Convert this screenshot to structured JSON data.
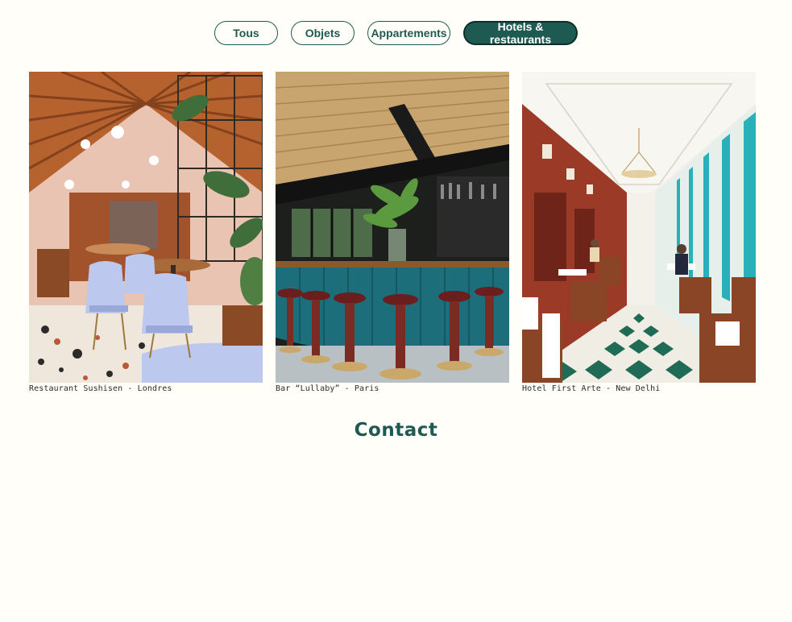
{
  "filters": {
    "items": [
      {
        "label": "Tous"
      },
      {
        "label": "Objets"
      },
      {
        "label": "Appartements"
      },
      {
        "label": "Hotels & restaurants"
      }
    ],
    "active_index": 3
  },
  "gallery": {
    "items": [
      {
        "caption": "Restaurant Sushisen - Londres"
      },
      {
        "caption": "Bar “Lullaby” - Paris"
      },
      {
        "caption": "Hotel First Arte - New Delhi"
      }
    ]
  },
  "contact": {
    "title": "Contact"
  },
  "colors": {
    "background": "#fffef8",
    "accent": "#1f5a52"
  }
}
